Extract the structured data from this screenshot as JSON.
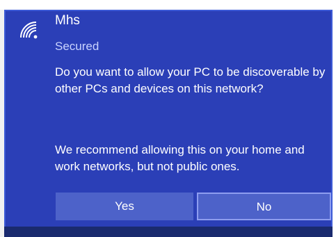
{
  "network": {
    "name": "Mhs",
    "status": "Secured",
    "icon": "wifi-signal-icon"
  },
  "dialog": {
    "question": "Do you want to allow your PC to be discoverable by other PCs and devices on this network?",
    "recommendation": "We recommend allowing this on your home and work networks, but not public ones."
  },
  "buttons": {
    "yes": "Yes",
    "no": "No"
  },
  "colors": {
    "panel": "#2b3fb7",
    "button": "#4d62c9",
    "button_focus_border": "#8e9df0"
  }
}
